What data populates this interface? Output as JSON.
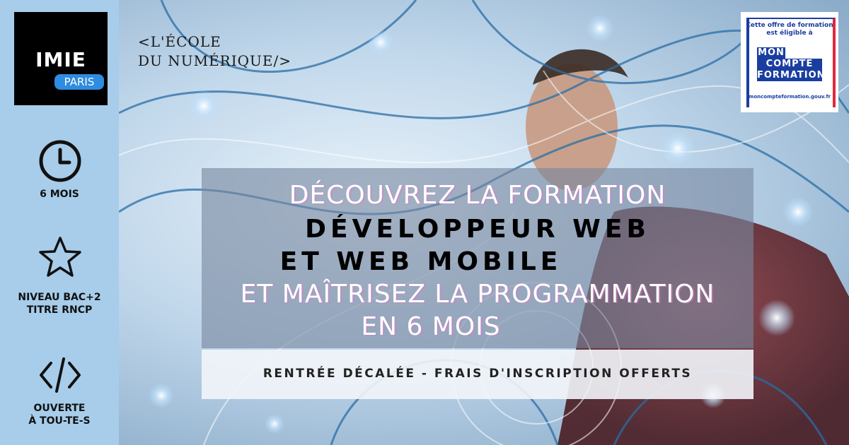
{
  "logo": {
    "name": "IMIE",
    "city": "PARIS"
  },
  "slogan": {
    "line1": "<L'ÉCOLE",
    "line2": "DU NUMÉRIQUE/>"
  },
  "features": [
    {
      "icon": "clock-icon",
      "line1": "6 MOIS",
      "line2": ""
    },
    {
      "icon": "star-icon",
      "line1": "NIVEAU BAC+2",
      "line2": "TITRE RNCP"
    },
    {
      "icon": "code-icon",
      "line1": "OUVERTE",
      "line2": "À TOU-TE-S"
    }
  ],
  "headline": {
    "line1": "DÉCOUVREZ LA FORMATION",
    "line2": "DÉVELOPPEUR WEB",
    "line3": "ET WEB MOBILE",
    "line4": "ET MAÎTRISEZ LA PROGRAMMATION",
    "line5": "EN 6 MOIS"
  },
  "subline": "RENTRÉE DÉCALÉE - FRAIS D'INSCRIPTION OFFERTS",
  "badge": {
    "line1": "Cette offre de formation",
    "line2": "est éligible à",
    "brand1": "MON",
    "brand2": "COMPTE",
    "brand3": "FORMATION",
    "url": "moncompteformation.gouv.fr"
  },
  "colors": {
    "sidebar": "#a7cdea",
    "logo_pill": "#2f8ce0",
    "badge_blue": "#1a3ea0",
    "badge_red": "#e0283a"
  }
}
